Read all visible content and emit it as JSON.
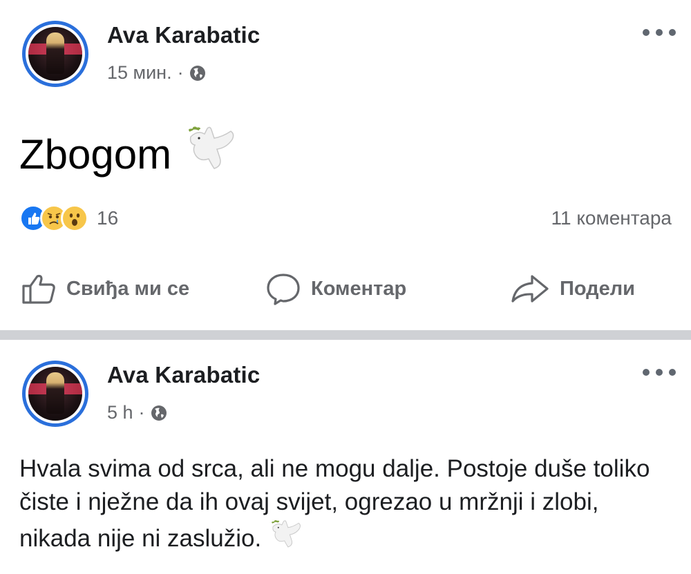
{
  "posts": [
    {
      "author": "Ava Karabatic",
      "time": "15 мин.",
      "separator": "·",
      "content": "Zbogom",
      "reactions": {
        "types": [
          "like-icon",
          "sad-icon",
          "wow-icon"
        ],
        "count": "16"
      },
      "comments": "11 коментара",
      "actions": {
        "like": "Свиђа ми се",
        "comment": "Коментар",
        "share": "Подели"
      }
    },
    {
      "author": "Ava Karabatic",
      "time": "5 h",
      "separator": "·",
      "content": "Hvala svima od srca, ali ne mogu dalje. Postoje duše toliko čiste i nježne da ih ovaj svijet, ogrezao u mržnji i zlobi, nikada nije ni zaslužio."
    }
  ],
  "colors": {
    "avatar_ring": "#2a6fdb",
    "secondary_text": "#65676b",
    "like_blue": "#1877f2",
    "reaction_yellow": "#f7c64a",
    "separator": "#cfd1d5"
  }
}
